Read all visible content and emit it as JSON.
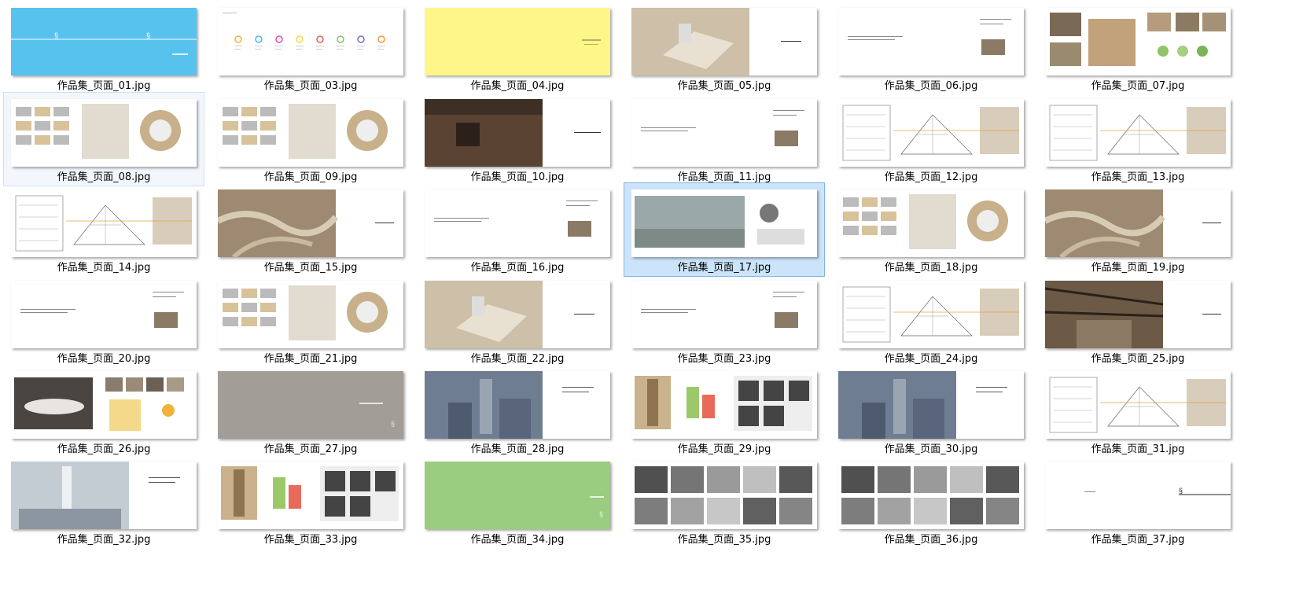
{
  "window": {
    "view": "large-icons"
  },
  "colors": {
    "selection_bg": "#cce4fa",
    "selection_border": "#7fb3e6",
    "hover_bg": "#f3f7fc"
  },
  "files": [
    {
      "name": "作品集_页面_01.jpg",
      "kind": "cover-blue",
      "selected": "none"
    },
    {
      "name": "作品集_页面_03.jpg",
      "kind": "timeline",
      "selected": "none"
    },
    {
      "name": "作品集_页面_04.jpg",
      "kind": "cover-yellow",
      "selected": "none"
    },
    {
      "name": "作品集_页面_05.jpg",
      "kind": "aerial-half",
      "selected": "none"
    },
    {
      "name": "作品集_页面_06.jpg",
      "kind": "text-page",
      "selected": "none"
    },
    {
      "name": "作品集_页面_07.jpg",
      "kind": "collage",
      "selected": "none"
    },
    {
      "name": "作品集_页面_08.jpg",
      "kind": "diagram-sheet",
      "selected": "hover"
    },
    {
      "name": "作品集_页面_09.jpg",
      "kind": "diagram-sheet",
      "selected": "none"
    },
    {
      "name": "作品集_页面_10.jpg",
      "kind": "wood-photo",
      "selected": "none"
    },
    {
      "name": "作品集_页面_11.jpg",
      "kind": "text-page",
      "selected": "none"
    },
    {
      "name": "作品集_页面_12.jpg",
      "kind": "drawing-sheet",
      "selected": "none"
    },
    {
      "name": "作品集_页面_13.jpg",
      "kind": "drawing-sheet",
      "selected": "none"
    },
    {
      "name": "作品集_页面_14.jpg",
      "kind": "drawing-sheet",
      "selected": "none"
    },
    {
      "name": "作品集_页面_15.jpg",
      "kind": "sepia-half",
      "selected": "none"
    },
    {
      "name": "作品集_页面_16.jpg",
      "kind": "text-page",
      "selected": "none"
    },
    {
      "name": "作品集_页面_17.jpg",
      "kind": "render-sheet",
      "selected": "selected"
    },
    {
      "name": "作品集_页面_18.jpg",
      "kind": "diagram-sheet",
      "selected": "none"
    },
    {
      "name": "作品集_页面_19.jpg",
      "kind": "sepia-half",
      "selected": "none"
    },
    {
      "name": "作品集_页面_20.jpg",
      "kind": "text-page",
      "selected": "none"
    },
    {
      "name": "作品集_页面_21.jpg",
      "kind": "diagram-sheet",
      "selected": "none"
    },
    {
      "name": "作品集_页面_22.jpg",
      "kind": "aerial-half",
      "selected": "none"
    },
    {
      "name": "作品集_页面_23.jpg",
      "kind": "text-page",
      "selected": "none"
    },
    {
      "name": "作品集_页面_24.jpg",
      "kind": "drawing-sheet",
      "selected": "none"
    },
    {
      "name": "作品集_页面_25.jpg",
      "kind": "dark-half",
      "selected": "none"
    },
    {
      "name": "作品集_页面_26.jpg",
      "kind": "model-sheet",
      "selected": "none"
    },
    {
      "name": "作品集_页面_27.jpg",
      "kind": "cover-grey",
      "selected": "none"
    },
    {
      "name": "作品集_页面_28.jpg",
      "kind": "city-half",
      "selected": "none"
    },
    {
      "name": "作品集_页面_29.jpg",
      "kind": "tower-sheet",
      "selected": "none"
    },
    {
      "name": "作品集_页面_30.jpg",
      "kind": "city-half",
      "selected": "none"
    },
    {
      "name": "作品集_页面_31.jpg",
      "kind": "drawing-sheet",
      "selected": "none"
    },
    {
      "name": "作品集_页面_32.jpg",
      "kind": "tower-half",
      "selected": "none"
    },
    {
      "name": "作品集_页面_33.jpg",
      "kind": "tower-sheet",
      "selected": "none"
    },
    {
      "name": "作品集_页面_34.jpg",
      "kind": "cover-green",
      "selected": "none"
    },
    {
      "name": "作品集_页面_35.jpg",
      "kind": "bw-grid",
      "selected": "none"
    },
    {
      "name": "作品集_页面_36.jpg",
      "kind": "bw-grid",
      "selected": "none"
    },
    {
      "name": "作品集_页面_37.jpg",
      "kind": "end-page",
      "selected": "none"
    }
  ]
}
